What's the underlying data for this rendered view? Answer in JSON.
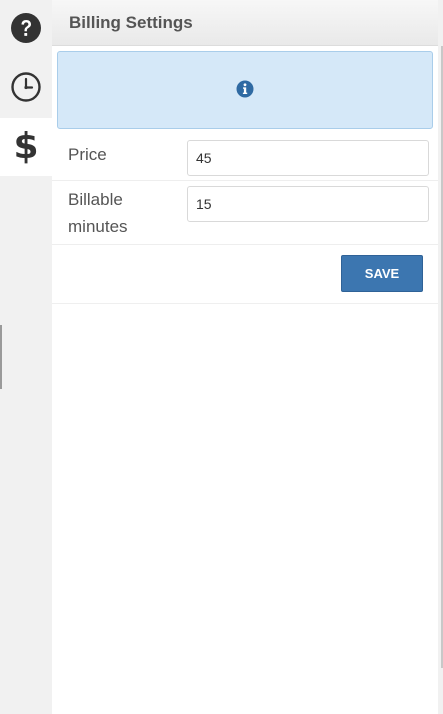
{
  "rail": {
    "items": [
      {
        "icon": "help-icon"
      },
      {
        "icon": "clock-icon"
      },
      {
        "icon": "dollar-icon",
        "label": "$",
        "active": true
      }
    ]
  },
  "header": {
    "title": "Billing Settings"
  },
  "info": {
    "icon": "info-icon",
    "color": "#d5e8f8"
  },
  "form": {
    "price": {
      "label": "Price",
      "value": "45"
    },
    "billable_minutes": {
      "label_line1": "Billable",
      "label_line2": "minutes",
      "value": "15"
    },
    "save_label": "SAVE",
    "accent": "#3c76b0"
  }
}
